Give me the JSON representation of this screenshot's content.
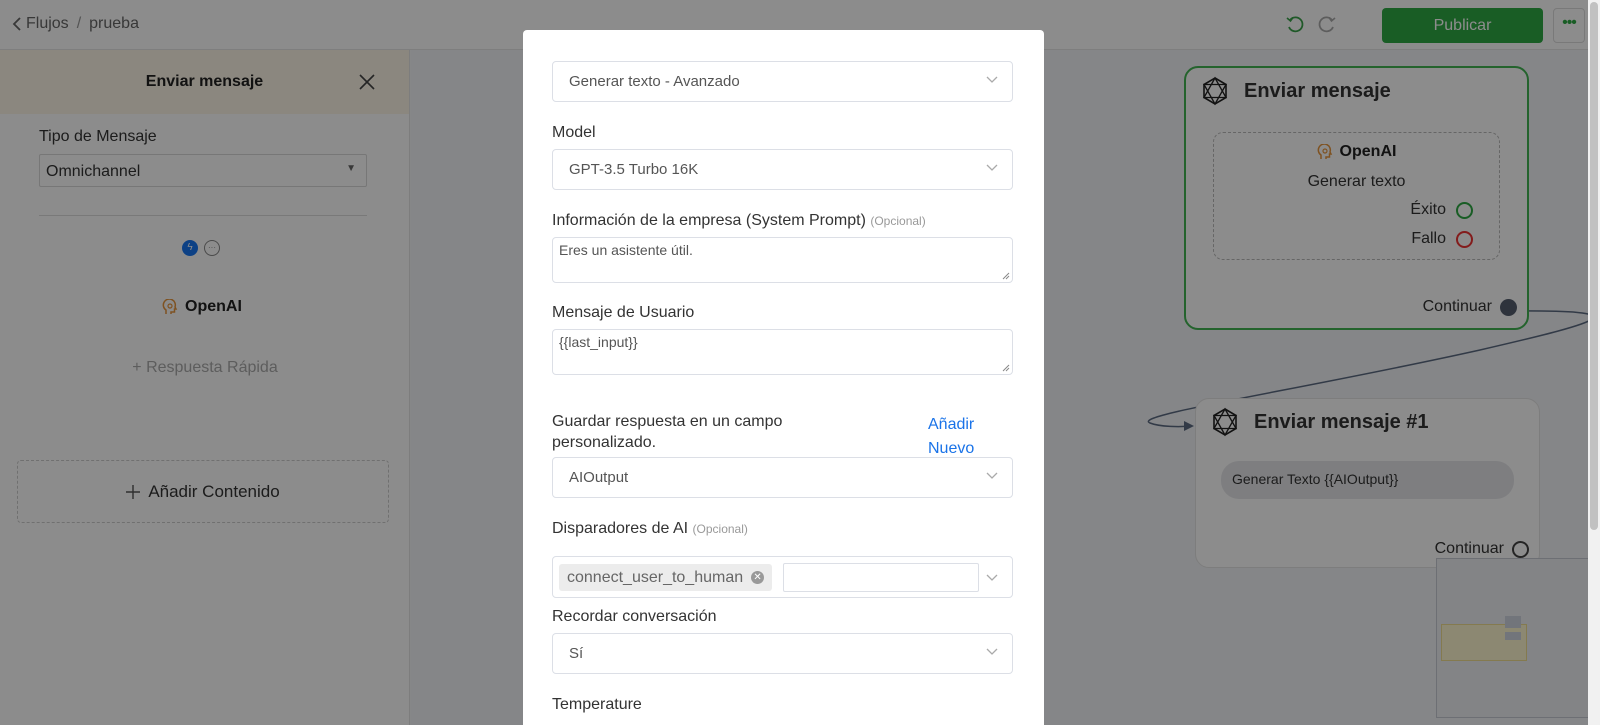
{
  "breadcrumb": {
    "back_label": "Flujos",
    "separator": "/",
    "current": "prueba"
  },
  "toolbar": {
    "undo_icon": "undo-icon",
    "redo_icon": "redo-icon",
    "publish_label": "Publicar",
    "more_label": "•••"
  },
  "left_panel": {
    "title": "Enviar mensaje",
    "close_icon": "close-icon",
    "message_type_label": "Tipo de Mensaje",
    "message_type_value": "Omnichannel",
    "channels": [
      "messenger-icon",
      "chat-icon"
    ],
    "integration_name": "OpenAI",
    "quick_reply_label": "+ Respuesta Rápida",
    "add_content_label": "Añadir Contenido"
  },
  "canvas": {
    "node1": {
      "title": "Enviar mensaje",
      "integration": "OpenAI",
      "action": "Generar texto",
      "success_label": "Éxito",
      "fail_label": "Fallo",
      "continue_label": "Continuar"
    },
    "node2": {
      "title": "Enviar mensaje #1",
      "content": "Generar Texto {{AIOutput}}",
      "continue_label": "Continuar"
    },
    "colors": {
      "success": "#2eaa44",
      "fail": "#ee3333",
      "accent_green": "#43b553"
    }
  },
  "modal": {
    "action_select": {
      "value_main": "Generar texto",
      "value_sep": " - ",
      "value_sub": "Avanzado"
    },
    "model": {
      "label": "Model",
      "value": "GPT-3.5 Turbo 16K"
    },
    "system_prompt": {
      "label": "Información de la empresa (System Prompt)",
      "optional": "(Opcional)",
      "value": "Eres un asistente útil."
    },
    "user_message": {
      "label": "Mensaje de Usuario",
      "value": "{{last_input}}"
    },
    "save_response": {
      "label_line1": "Guardar respuesta en un campo",
      "label_line2": "personalizado.",
      "add_new_line1": "Añadir",
      "add_new_line2": "Nuevo",
      "value": "AIOutput"
    },
    "ai_triggers": {
      "label": "Disparadores de AI",
      "optional": "(Opcional)",
      "tags": [
        "connect_user_to_human"
      ]
    },
    "remember": {
      "label": "Recordar conversación",
      "value": "Sí"
    },
    "temperature": {
      "label": "Temperature"
    }
  }
}
